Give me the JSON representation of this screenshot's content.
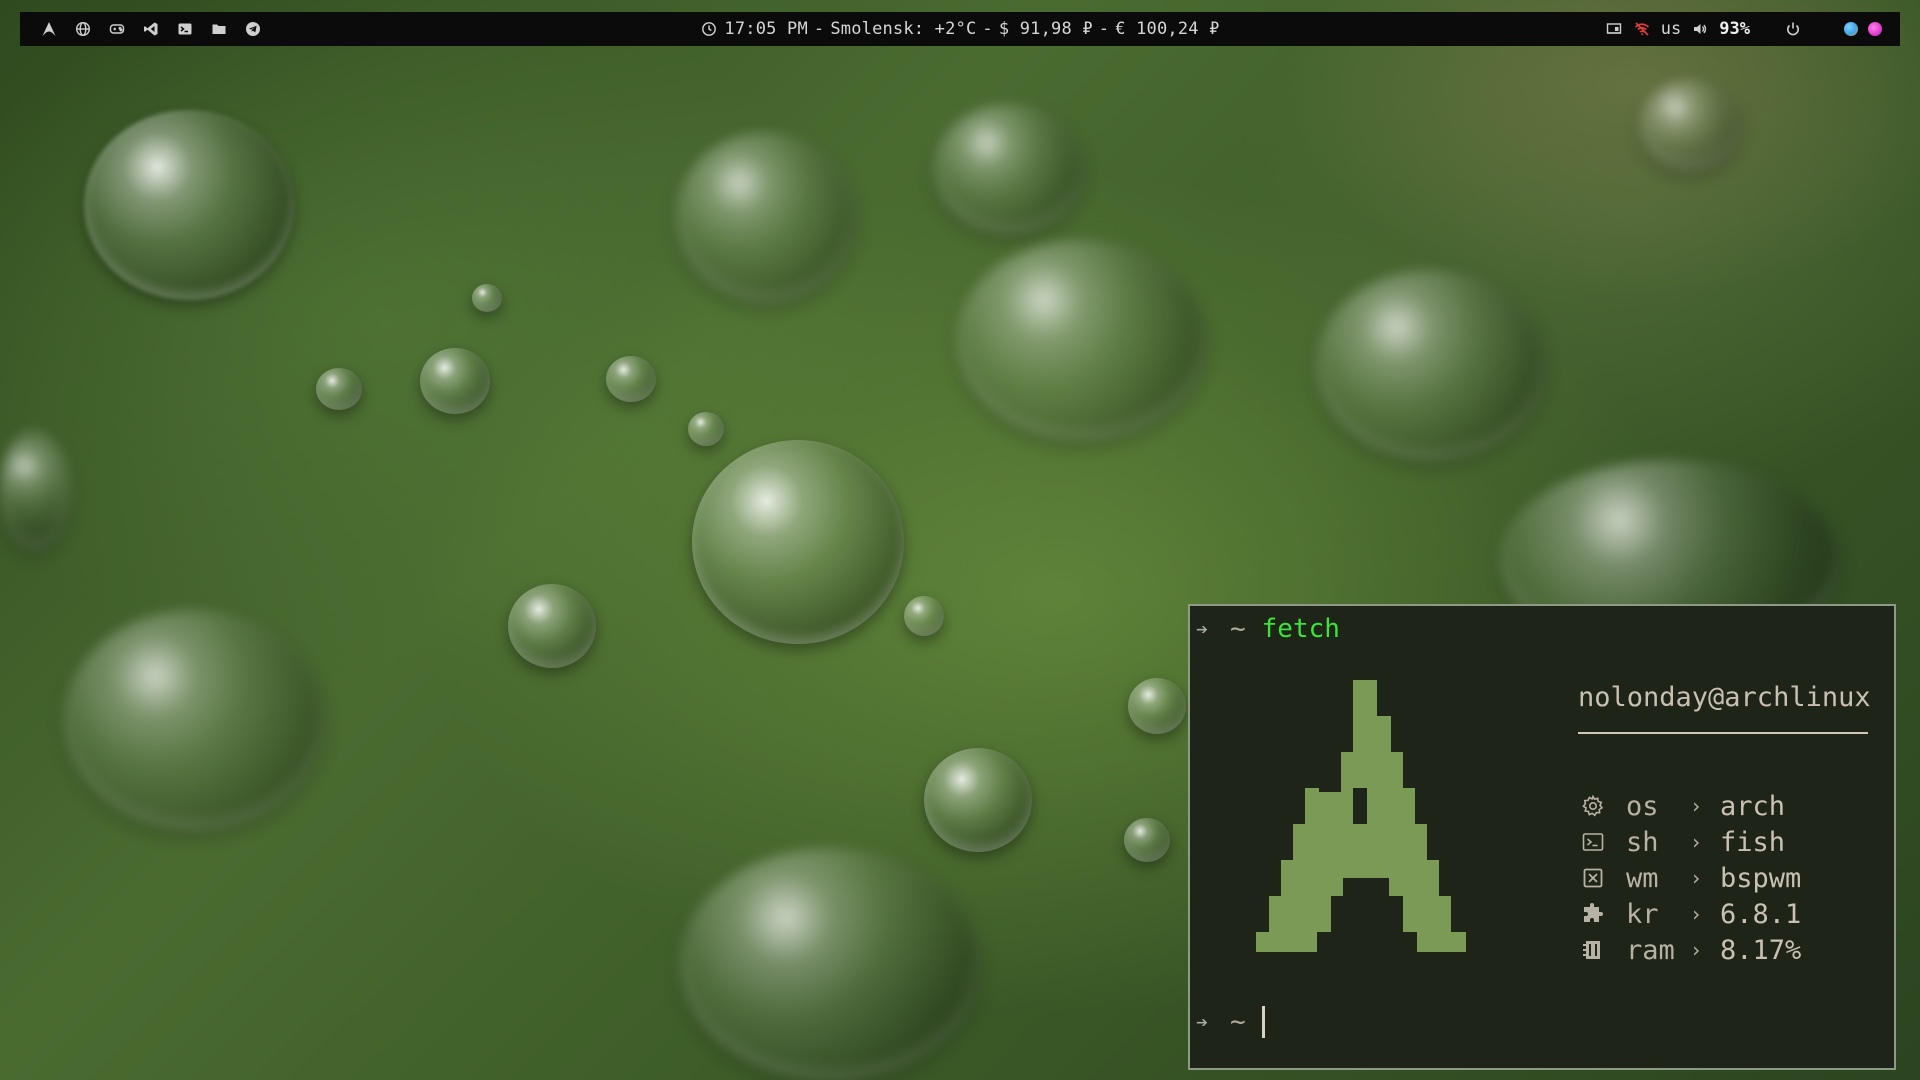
{
  "topbar": {
    "left_icons": [
      "arch-logo-icon",
      "globe-icon",
      "gamepad-icon",
      "vscode-icon",
      "terminal-icon",
      "folder-icon",
      "telegram-icon"
    ],
    "time": "17:05 PM",
    "weather": "Smolensk: +2°C",
    "usd_rate": "$ 91,98 ₽",
    "eur_rate": "€ 100,24 ₽",
    "separator": "-",
    "keyboard_layout": "us",
    "battery": "93%",
    "colors": {
      "bar_bg": "#0b0b0b",
      "wifi_icon": "#e03c3c",
      "dot_blue": "#3fa6e8",
      "dot_pink": "#e23ccf"
    }
  },
  "terminal": {
    "prompt_symbol": "~",
    "command": "fetch",
    "userhost": "nolonday@archlinux",
    "info": [
      {
        "icon": "gear-icon",
        "key": "os",
        "value": "arch"
      },
      {
        "icon": "terminal-icon",
        "key": "sh",
        "value": "fish"
      },
      {
        "icon": "window-icon",
        "key": "wm",
        "value": "bspwm"
      },
      {
        "icon": "puzzle-icon",
        "key": "kr",
        "value": "6.8.1"
      },
      {
        "icon": "memory-icon",
        "key": "ram",
        "value": "8.17%"
      }
    ],
    "colors": {
      "bg": "#1e2417",
      "command": "#3ee23a",
      "logo": "#7a9a56",
      "border": "#8e9986"
    }
  }
}
